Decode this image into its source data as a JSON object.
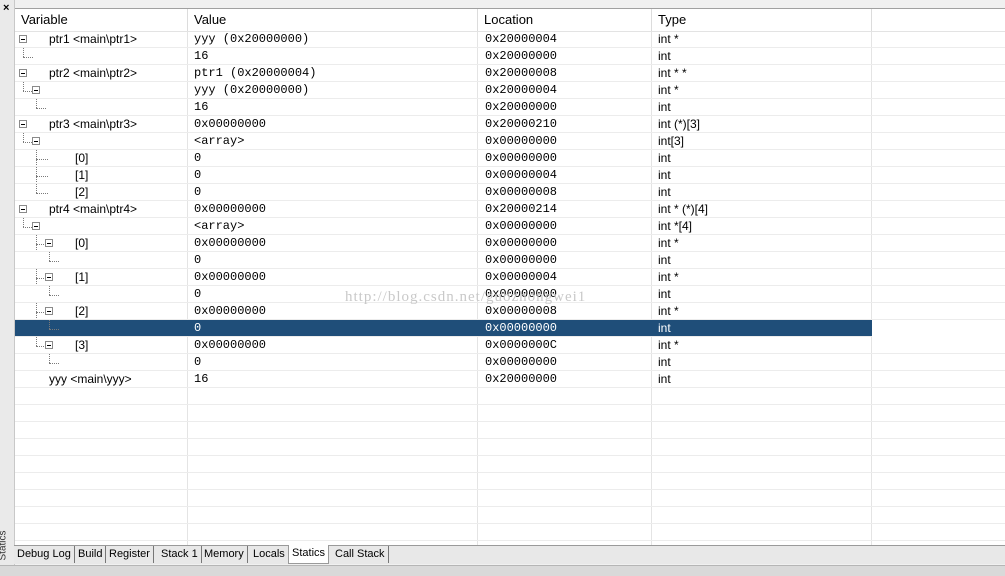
{
  "window": {
    "close_glyph": "×",
    "title": "Statics"
  },
  "columns": [
    "Variable",
    "Value",
    "Location",
    "Type"
  ],
  "rows": [
    {
      "var": "ptr1 <main\\ptr1>",
      "val": "yyy (0x20000000)",
      "loc": "0x20000004",
      "type": "int *"
    },
    {
      "var": "",
      "val": "16",
      "loc": "0x20000000",
      "type": "int"
    },
    {
      "var": "ptr2 <main\\ptr2>",
      "val": "ptr1 (0x20000004)",
      "loc": "0x20000008",
      "type": "int * *"
    },
    {
      "var": "",
      "val": "yyy (0x20000000)",
      "loc": "0x20000004",
      "type": "int *"
    },
    {
      "var": "",
      "val": "16",
      "loc": "0x20000000",
      "type": "int"
    },
    {
      "var": "ptr3 <main\\ptr3>",
      "val": "0x00000000",
      "loc": "0x20000210",
      "type": "int (*)[3]"
    },
    {
      "var": "",
      "val": "<array>",
      "loc": "0x00000000",
      "type": "int[3]"
    },
    {
      "var": "[0]",
      "val": "0",
      "loc": "0x00000000",
      "type": "int"
    },
    {
      "var": "[1]",
      "val": "0",
      "loc": "0x00000004",
      "type": "int"
    },
    {
      "var": "[2]",
      "val": "0",
      "loc": "0x00000008",
      "type": "int"
    },
    {
      "var": "ptr4 <main\\ptr4>",
      "val": "0x00000000",
      "loc": "0x20000214",
      "type": "int * (*)[4]"
    },
    {
      "var": "",
      "val": "<array>",
      "loc": "0x00000000",
      "type": "int *[4]"
    },
    {
      "var": "[0]",
      "val": "0x00000000",
      "loc": "0x00000000",
      "type": "int *"
    },
    {
      "var": "",
      "val": "0",
      "loc": "0x00000000",
      "type": "int"
    },
    {
      "var": "[1]",
      "val": "0x00000000",
      "loc": "0x00000004",
      "type": "int *"
    },
    {
      "var": "",
      "val": "0",
      "loc": "0x00000000",
      "type": "int"
    },
    {
      "var": "[2]",
      "val": "0x00000000",
      "loc": "0x00000008",
      "type": "int *"
    },
    {
      "var": "",
      "val": "0",
      "loc": "0x00000000",
      "type": "int"
    },
    {
      "var": "[3]",
      "val": "0x00000000",
      "loc": "0x0000000C",
      "type": "int *"
    },
    {
      "var": "",
      "val": "0",
      "loc": "0x00000000",
      "type": "int"
    },
    {
      "var": "yyy <main\\yyy>",
      "val": "16",
      "loc": "0x20000000",
      "type": "int"
    }
  ],
  "selected_row": 17,
  "watermark": "http://blog.csdn.net/guozhongwei1",
  "tabs": [
    "Debug Log",
    "Build",
    "Register",
    "Stack 1",
    "Memory",
    "Locals",
    "Statics",
    "Call Stack"
  ],
  "active_tab": "Statics",
  "colors": {
    "selection": "#1f4e79",
    "grid": "#ececec"
  }
}
